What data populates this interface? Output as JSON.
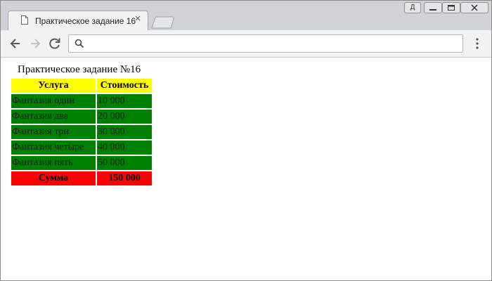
{
  "browser": {
    "tab": {
      "title": "Практическое задание 16",
      "close_glyph": "×"
    },
    "user_badge": "Д",
    "address": {
      "value": "",
      "placeholder": ""
    },
    "icons": {
      "back": "back-arrow-icon",
      "forward": "forward-arrow-icon",
      "reload": "reload-icon",
      "search": "search-icon",
      "menu": "kebab-menu-icon"
    }
  },
  "page": {
    "heading": "Практическое задание №16",
    "table": {
      "headers": [
        "Услуга",
        "Стоимость"
      ],
      "rows": [
        {
          "service": "Фантазия один",
          "cost": "10 000"
        },
        {
          "service": "Фантазия два",
          "cost": "20 000"
        },
        {
          "service": "Фантазия три",
          "cost": "30 000"
        },
        {
          "service": "Фантазия четыре",
          "cost": "40 000"
        },
        {
          "service": "Фантазия пять",
          "cost": "50 000"
        }
      ],
      "total": {
        "label": "Сумма",
        "value": "150 000"
      }
    },
    "colors": {
      "header_bg": "#ffff00",
      "row_bg": "#008000",
      "total_bg": "#ff0000"
    }
  }
}
